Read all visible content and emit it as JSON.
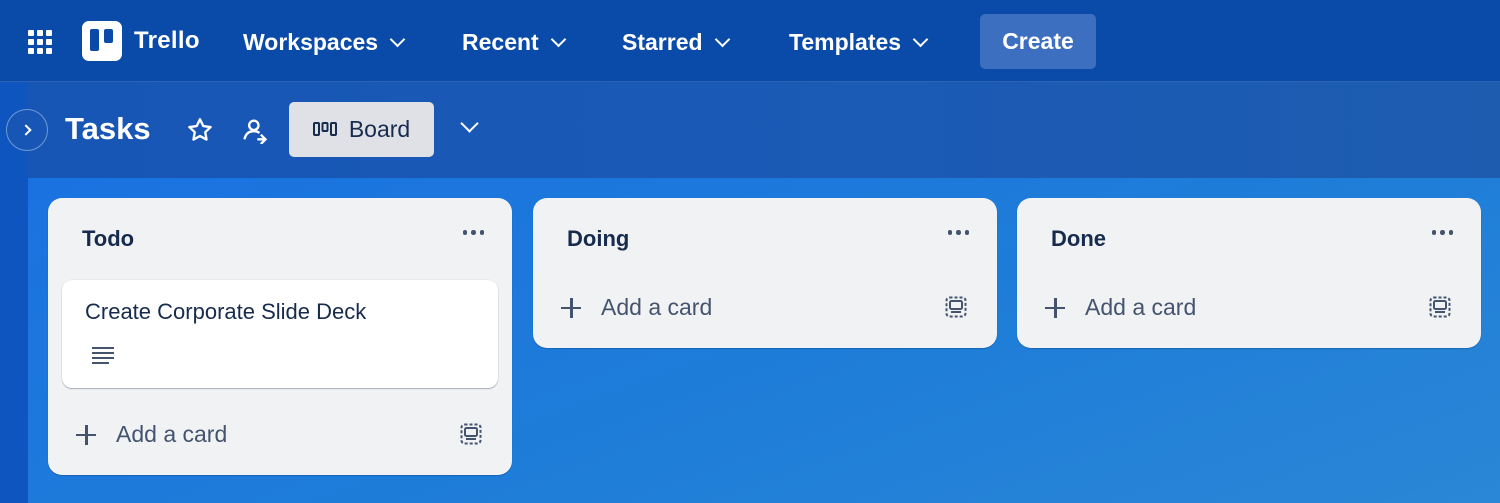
{
  "topbar": {
    "brand": "Trello",
    "nav": [
      {
        "label": "Workspaces"
      },
      {
        "label": "Recent"
      },
      {
        "label": "Starred"
      },
      {
        "label": "Templates"
      }
    ],
    "create_label": "Create"
  },
  "board": {
    "title": "Tasks",
    "view_label": "Board"
  },
  "lists": [
    {
      "title": "Todo",
      "cards": [
        {
          "title": "Create Corporate Slide Deck",
          "has_description": true
        }
      ],
      "add_label": "Add a card"
    },
    {
      "title": "Doing",
      "cards": [],
      "add_label": "Add a card"
    },
    {
      "title": "Done",
      "cards": [],
      "add_label": "Add a card"
    }
  ],
  "colors": {
    "nav_bg": "#0a4aa8",
    "header_bg": "#1756b5",
    "canvas_bg": "#1f7ed8",
    "list_bg": "#f1f2f4",
    "text": "#172b4d"
  }
}
